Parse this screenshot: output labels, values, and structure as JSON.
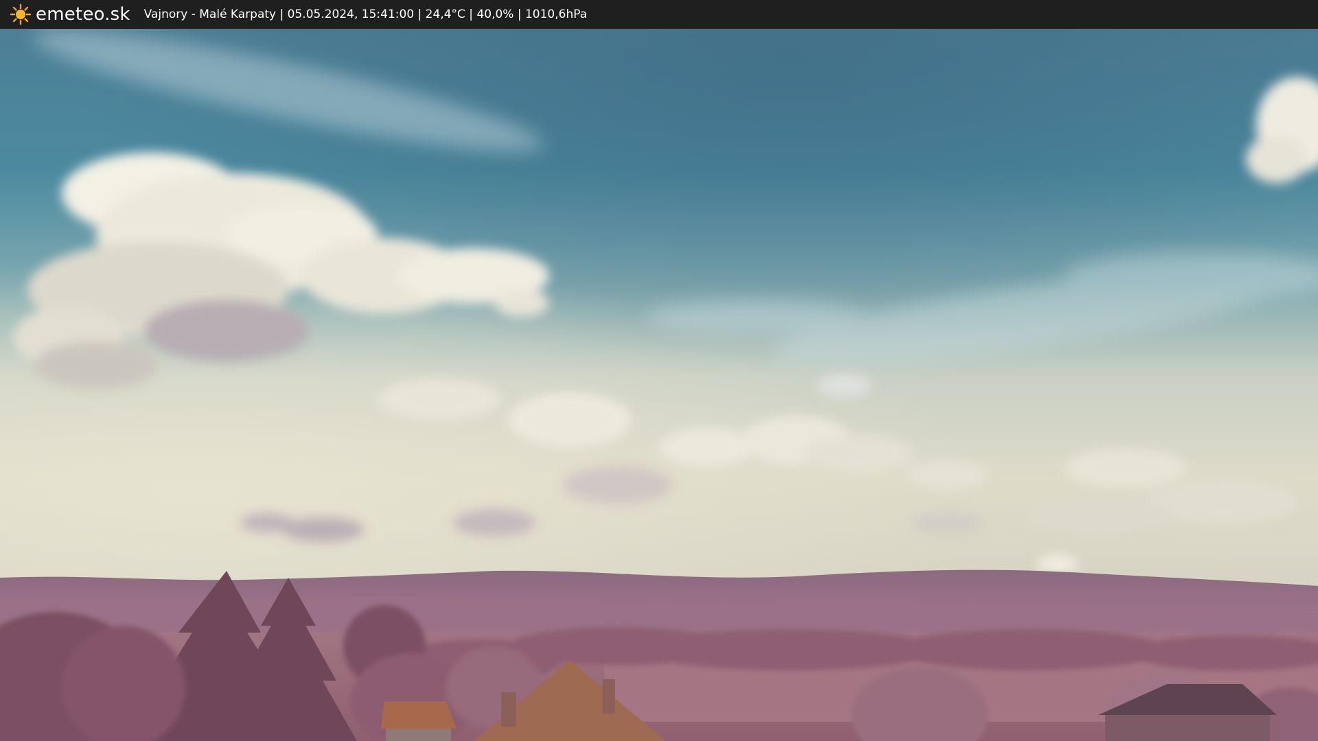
{
  "header": {
    "logo_text": "emeteo.sk",
    "logo_icon": "sun-icon",
    "caption": "Vajnory - Malé Karpaty | 05.05.2024, 15:41:00 | 24,4°C | 40,0% | 1010,6hPa"
  },
  "colors": {
    "bar_bg": "#1f1f1f",
    "sun": "#f4a31a",
    "sky_top": "#4f8a9c",
    "sky_mid": "#8fb6b8",
    "sky_low": "#d8d8c6",
    "hills": "#a07088",
    "vegetation": "#8a5c70",
    "roof": "#a4664a"
  }
}
